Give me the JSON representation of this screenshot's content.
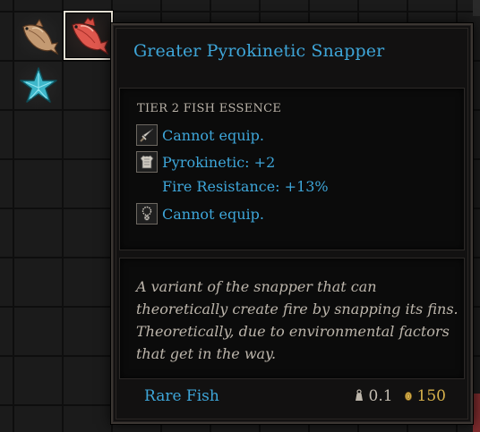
{
  "inventory": {
    "slots": [
      {
        "item": "fish-icon",
        "selected": false
      },
      {
        "item": "red-snapper-icon",
        "selected": true
      },
      {
        "item": "starfish-icon",
        "selected": false
      }
    ]
  },
  "tooltip": {
    "title": "Greater Pyrokinetic Snapper",
    "tier": "TIER 2 FISH ESSENCE",
    "properties": [
      {
        "icon": "dagger-icon",
        "text": "Cannot equip."
      },
      {
        "icon": "armor-icon",
        "text": "Pyrokinetic: +2"
      },
      {
        "icon": "",
        "text": "Fire Resistance: +13%"
      },
      {
        "icon": "amulet-icon",
        "text": "Cannot equip."
      }
    ],
    "description": "A variant of the snapper that can theoretically create fire by snapping its fins. Theoretically, due to environmental factors that get in the way.",
    "rarity": "Rare Fish",
    "weight": "0.1",
    "value": "150",
    "colors": {
      "accent": "#3ea6d9",
      "gold": "#d8b24c",
      "text": "#bcb5ab"
    }
  }
}
